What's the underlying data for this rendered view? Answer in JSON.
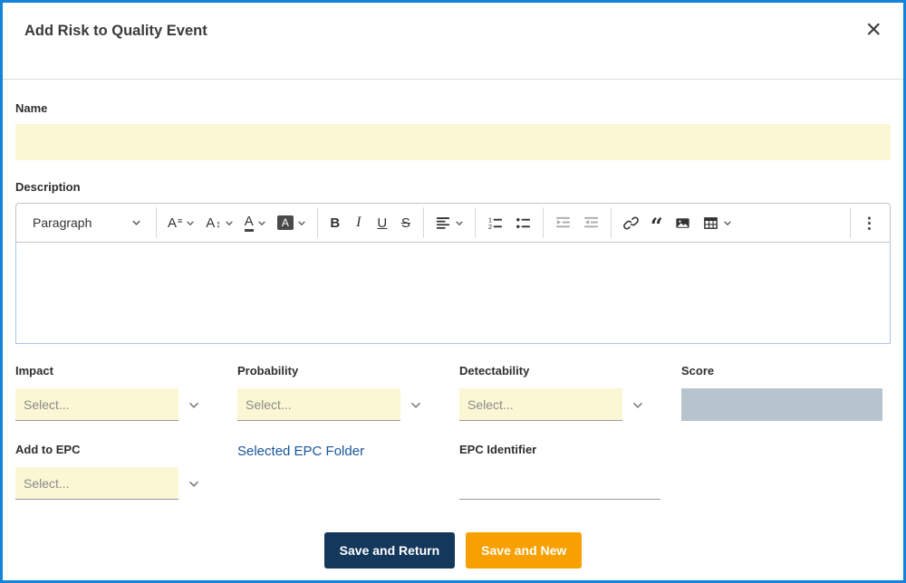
{
  "dialog": {
    "title": "Add Risk to Quality Event",
    "close_glyph": "×"
  },
  "fields": {
    "name": {
      "label": "Name",
      "value": ""
    },
    "description": {
      "label": "Description"
    },
    "impact": {
      "label": "Impact",
      "placeholder": "Select..."
    },
    "probability": {
      "label": "Probability",
      "placeholder": "Select..."
    },
    "detectability": {
      "label": "Detectability",
      "placeholder": "Select..."
    },
    "score": {
      "label": "Score",
      "value": ""
    },
    "add_to_epc": {
      "label": "Add to EPC",
      "placeholder": "Select..."
    },
    "selected_epc_folder": {
      "label": "Selected EPC Folder"
    },
    "epc_identifier": {
      "label": "EPC Identifier",
      "value": ""
    }
  },
  "editor": {
    "heading_value": "Paragraph",
    "glyphs": {
      "font_family": "A",
      "font_family_marks": "≡",
      "font_size": "A",
      "font_size_marks": "↕",
      "font_color": "A",
      "font_background": "A",
      "bold": "B",
      "italic": "I",
      "underline": "U",
      "strikethrough": "S",
      "blockquote": "“",
      "overflow": "⋮"
    },
    "toolbar_icon_names": [
      "heading-dropdown",
      "font-family",
      "font-size",
      "font-color",
      "font-background-color",
      "bold",
      "italic",
      "underline",
      "strikethrough",
      "text-alignment",
      "numbered-list",
      "bulleted-list",
      "increase-indent",
      "decrease-indent",
      "link",
      "block-quote",
      "insert-image",
      "insert-table",
      "show-more-items"
    ],
    "content_value": ""
  },
  "buttons": {
    "save_and_return": "Save and Return",
    "save_and_new": "Save and New"
  },
  "colors": {
    "accent_blue": "#1584d8",
    "input_yellow": "#fbf6d3",
    "score_gray": "#b7c3cd",
    "navy": "#14375c",
    "orange": "#f7a000",
    "link_blue": "#17549b"
  }
}
